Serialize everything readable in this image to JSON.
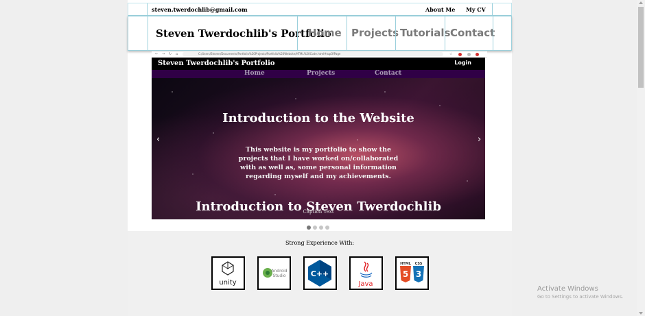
{
  "topbar": {
    "email": "steven.twerdochlib@gmail.com",
    "about": "About Me",
    "cv": "My CV"
  },
  "header": {
    "title": "Steven Twerdochlib's Portfolio",
    "nav": [
      "Home",
      "Projects",
      "Tutorials",
      "Contact"
    ]
  },
  "carousel": {
    "browser_url": "C:/Users/Steven/Documents/Portfolio%20Projects/Portfolio%20Website/HTML%20Code.html#topOfPage",
    "site_brand": "Steven Twerdochlib's Portfolio",
    "login": "Login",
    "site_nav": [
      "Home",
      "Projects",
      "Contact"
    ],
    "heading": "Introduction to the Website",
    "paragraph": "This website is my portfolio to show the projects that I have worked on/collaborated with as well as, some personal information regarding myself and my achievements.",
    "subheading": "Introduction to Steven Twerdochlib",
    "caption": "Caption Text",
    "prev": "‹",
    "next": "›",
    "slide_count": 4,
    "active_slide": 1
  },
  "experience": {
    "label": "Strong Experience With:",
    "logos": [
      {
        "name": "unity",
        "text": "unity",
        "icon": "unity-icon"
      },
      {
        "name": "android-studio",
        "text": "Android Studio",
        "icon": "android-studio-icon"
      },
      {
        "name": "cpp",
        "text": "C++",
        "icon": "cpp-icon",
        "color": "#00599c"
      },
      {
        "name": "java",
        "text": "Java",
        "icon": "java-icon",
        "color": "#e11e22"
      },
      {
        "name": "html-css",
        "text_html": "HTML",
        "text_css": "CSS",
        "html_color": "#e44d26",
        "css_color": "#1572b6"
      }
    ]
  },
  "watermark": {
    "line1": "Activate Windows",
    "line2": "Go to Settings to activate Windows."
  }
}
